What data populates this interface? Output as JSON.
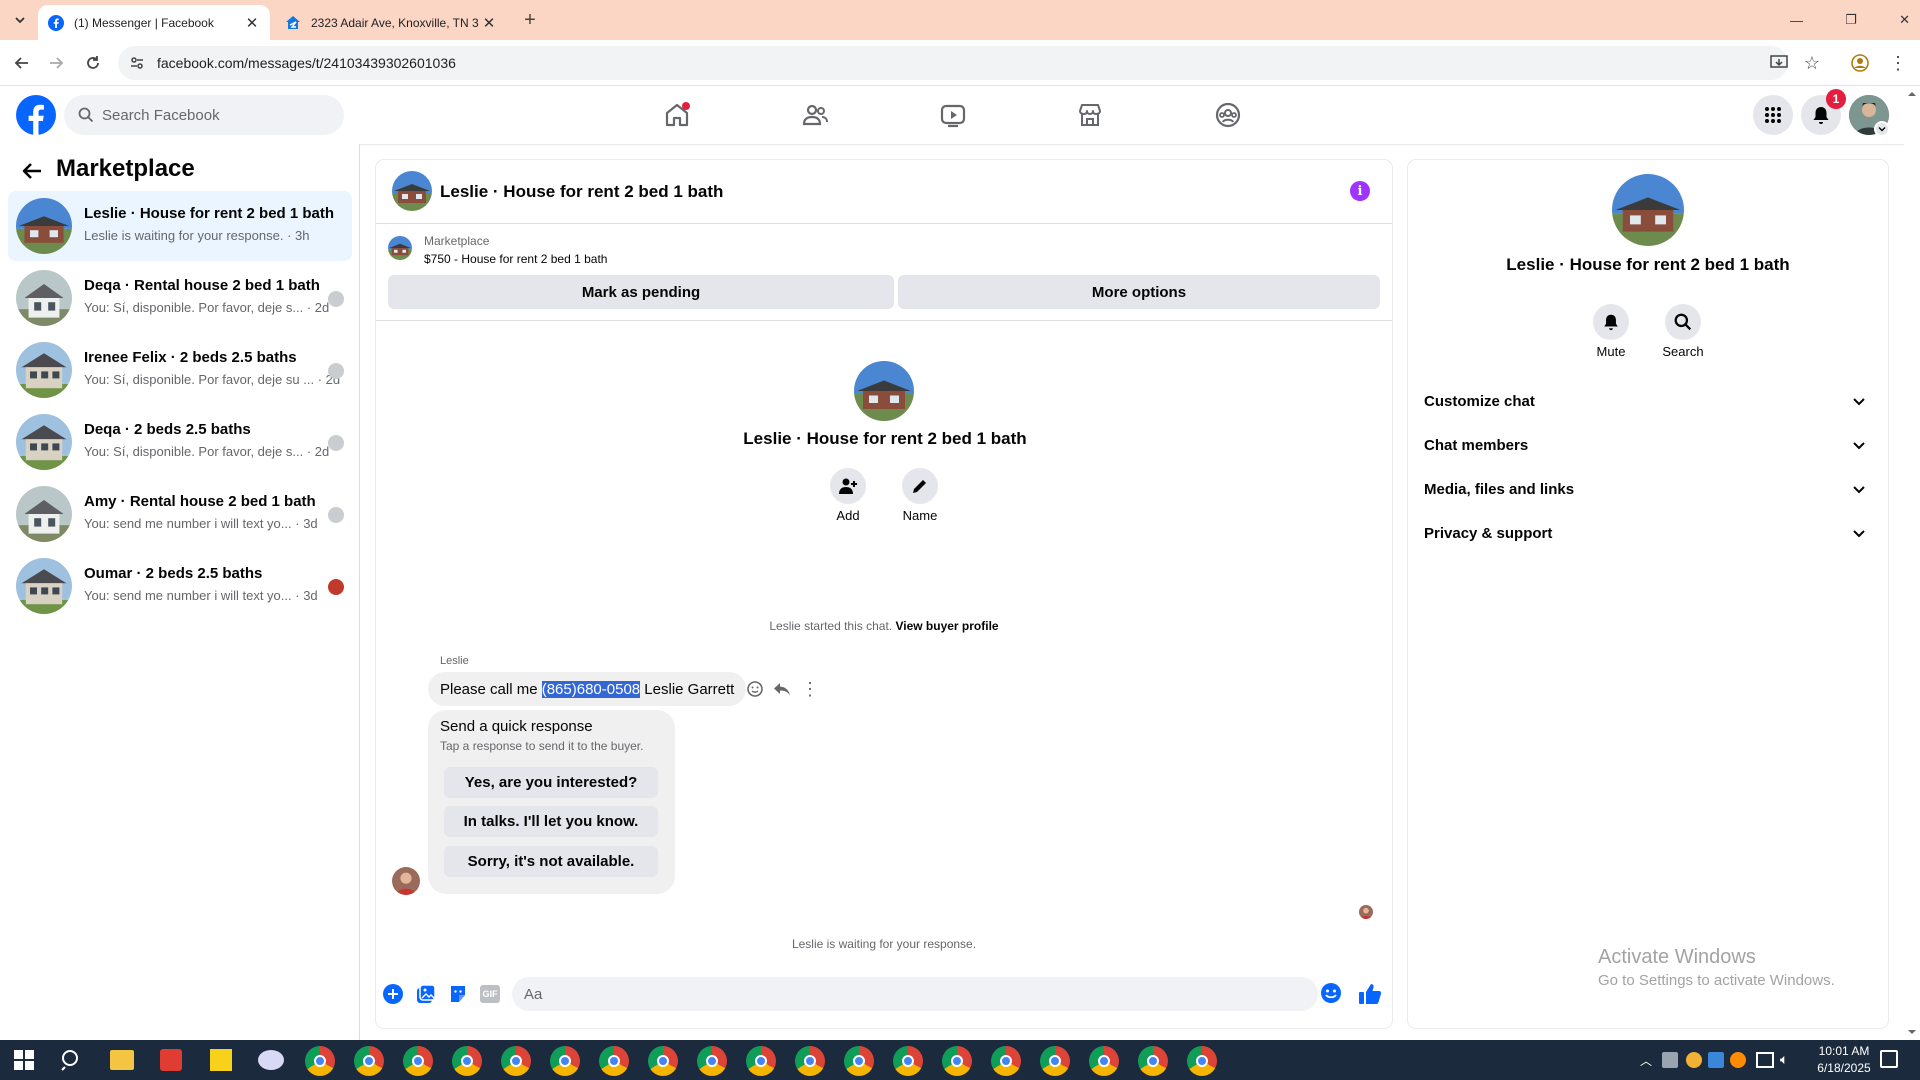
{
  "browser": {
    "tabs": [
      {
        "title": "(1) Messenger | Facebook"
      },
      {
        "title": "2323 Adair Ave, Knoxville, TN 3"
      }
    ],
    "url": "facebook.com/messages/t/24103439302601036"
  },
  "fb": {
    "search_placeholder": "Search Facebook",
    "notification_count": "1"
  },
  "sidebar": {
    "title": "Marketplace",
    "conversations": [
      {
        "title": "Leslie · House for rent 2 bed 1 bath",
        "preview": "Leslie is waiting for your response.",
        "time": "· 3h",
        "active": true
      },
      {
        "title": "Deqa · Rental house 2 bed 1 bath",
        "preview": "You: Sí, disponible. Por favor, deje s...",
        "time": "· 2d"
      },
      {
        "title": "Irenee Felix · 2 beds 2.5 baths",
        "preview": "You: Sí, disponible. Por favor, deje su ...",
        "time": "· 2d"
      },
      {
        "title": "Deqa · 2 beds 2.5 baths",
        "preview": "You: Sí, disponible. Por favor, deje s...",
        "time": "· 2d"
      },
      {
        "title": "Amy · Rental house 2 bed 1 bath",
        "preview": "You: send me number i will text yo...",
        "time": "· 3d"
      },
      {
        "title": "Oumar · 2 beds 2.5 baths",
        "preview": "You: send me number i will text yo...",
        "time": "· 3d"
      }
    ]
  },
  "chat": {
    "header_title": "Leslie · House for rent 2 bed 1 bath",
    "listing_label": "Marketplace",
    "listing_price_title": "$750 - House for rent 2 bed 1 bath",
    "mark_pending": "Mark as pending",
    "more_options": "More options",
    "intro_title": "Leslie · House for rent 2 bed 1 bath",
    "add_label": "Add",
    "name_label": "Name",
    "started_text": "Leslie started this chat.",
    "view_profile": "View buyer profile",
    "sender_name": "Leslie",
    "message_before": "Please call me ",
    "message_phone": "(865)680-0508",
    "message_after": " Leslie Garrett",
    "quick_title": "Send a quick response",
    "quick_sub": "Tap a response to send it to the buyer.",
    "quick_responses": [
      "Yes, are you interested?",
      "In talks. I'll let you know.",
      "Sorry, it's not available."
    ],
    "waiting_text": "Leslie is waiting for your response.",
    "composer_placeholder": "Aa"
  },
  "details": {
    "title": "Leslie · House for rent 2 bed 1 bath",
    "mute": "Mute",
    "search": "Search",
    "sections": [
      "Customize chat",
      "Chat members",
      "Media, files and links",
      "Privacy & support"
    ]
  },
  "watermark": {
    "line1": "Activate Windows",
    "line2": "Go to Settings to activate Windows."
  },
  "taskbar": {
    "time": "10:01 AM",
    "date": "6/18/2025"
  },
  "colors": {
    "fb_blue": "#0866ff",
    "active_row": "#ebf5ff",
    "tabbar": "#fbd6c5",
    "purple_info": "#a033ff"
  }
}
